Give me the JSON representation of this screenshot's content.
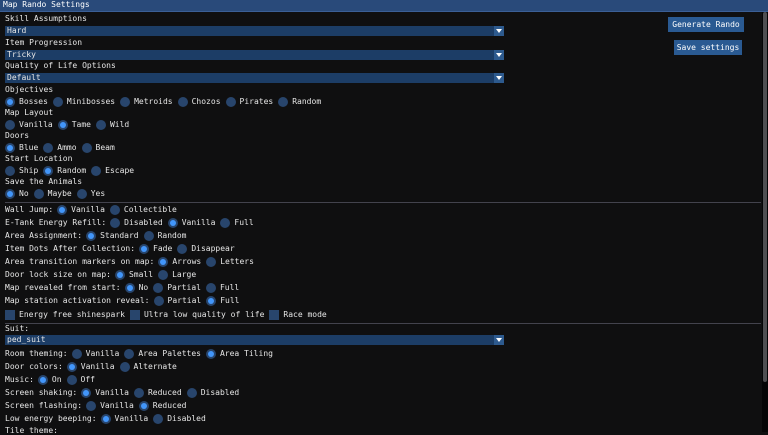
{
  "window": {
    "title": "Map Rando Settings"
  },
  "buttons": {
    "generate": "Generate Rando",
    "save": "Save settings"
  },
  "skill": {
    "label": "Skill Assumptions",
    "value": "Hard"
  },
  "item": {
    "label": "Item Progression",
    "value": "Tricky"
  },
  "qol": {
    "label": "Quality of Life Options",
    "value": "Default"
  },
  "objectives": {
    "label": "Objectives",
    "options": [
      "Bosses",
      "Minibosses",
      "Metroids",
      "Chozos",
      "Pirates",
      "Random"
    ],
    "selected": "Bosses"
  },
  "map_layout": {
    "label": "Map Layout",
    "options": [
      "Vanilla",
      "Tame",
      "Wild"
    ],
    "selected": "Tame"
  },
  "doors": {
    "label": "Doors",
    "options": [
      "Blue",
      "Ammo",
      "Beam"
    ],
    "selected": "Blue"
  },
  "start": {
    "label": "Start Location",
    "options": [
      "Ship",
      "Random",
      "Escape"
    ],
    "selected": "Random"
  },
  "animals": {
    "label": "Save the Animals",
    "options": [
      "No",
      "Maybe",
      "Yes"
    ],
    "selected": "No"
  },
  "wall_jump": {
    "label": "Wall Jump:",
    "options": [
      "Vanilla",
      "Collectible"
    ],
    "selected": "Vanilla"
  },
  "etank": {
    "label": "E-Tank Energy Refill:",
    "options": [
      "Disabled",
      "Vanilla",
      "Full"
    ],
    "selected": "Vanilla"
  },
  "area_assign": {
    "label": "Area Assignment:",
    "options": [
      "Standard",
      "Random"
    ],
    "selected": "Standard"
  },
  "item_dots": {
    "label": "Item Dots After Collection:",
    "options": [
      "Fade",
      "Disappear"
    ],
    "selected": "Fade"
  },
  "transition": {
    "label": "Area transition markers on map:",
    "options": [
      "Arrows",
      "Letters"
    ],
    "selected": "Arrows"
  },
  "door_lock": {
    "label": "Door lock size on map:",
    "options": [
      "Small",
      "Large"
    ],
    "selected": "Small"
  },
  "map_revealed": {
    "label": "Map revealed from start:",
    "options": [
      "No",
      "Partial",
      "Full"
    ],
    "selected": "No"
  },
  "map_station": {
    "label": "Map station activation reveal:",
    "options": [
      "Partial",
      "Full"
    ],
    "selected": "Full"
  },
  "checks": [
    "Energy free shinespark",
    "Ultra low quality of life",
    "Race mode"
  ],
  "suit": {
    "label": "Suit:",
    "value": "ped_suit"
  },
  "room_theming": {
    "label": "Room theming:",
    "options": [
      "Vanilla",
      "Area Palettes",
      "Area Tiling"
    ],
    "selected": "Area Tiling"
  },
  "door_colors": {
    "label": "Door colors:",
    "options": [
      "Vanilla",
      "Alternate"
    ],
    "selected": "Vanilla"
  },
  "music": {
    "label": "Music:",
    "options": [
      "On",
      "Off"
    ],
    "selected": "On"
  },
  "shaking": {
    "label": "Screen shaking:",
    "options": [
      "Vanilla",
      "Reduced",
      "Disabled"
    ],
    "selected": "Vanilla"
  },
  "flashing": {
    "label": "Screen flashing:",
    "options": [
      "Vanilla",
      "Reduced"
    ],
    "selected": "Reduced"
  },
  "low_energy": {
    "label": "Low energy beeping:",
    "options": [
      "Vanilla",
      "Disabled"
    ],
    "selected": "Vanilla"
  },
  "tile_theme": {
    "label": "Tile theme:"
  },
  "colors": {
    "title_bar": "#294a7a",
    "accent": "#4296fa",
    "frame": "#28456c",
    "combo": "#1c3d66"
  }
}
